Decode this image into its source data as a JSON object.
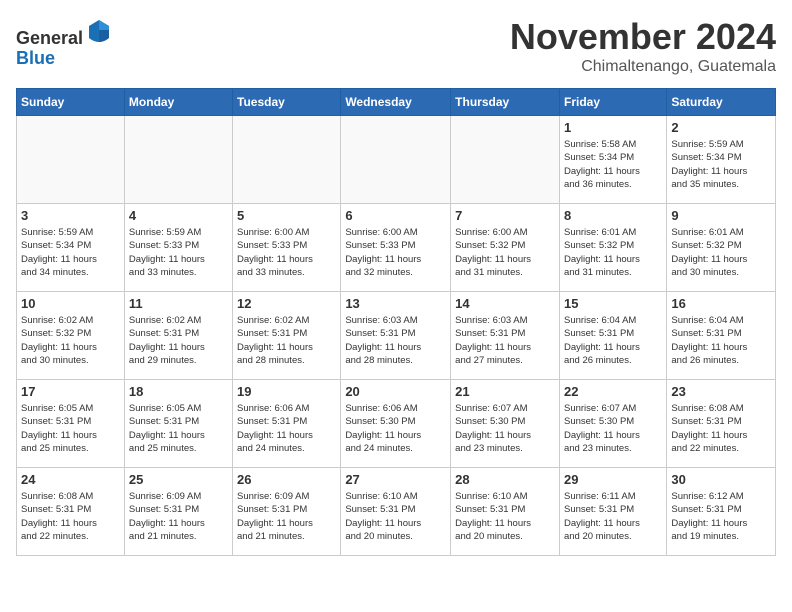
{
  "header": {
    "logo_general": "General",
    "logo_blue": "Blue",
    "month_title": "November 2024",
    "location": "Chimaltenango, Guatemala"
  },
  "weekdays": [
    "Sunday",
    "Monday",
    "Tuesday",
    "Wednesday",
    "Thursday",
    "Friday",
    "Saturday"
  ],
  "weeks": [
    [
      {
        "day": "",
        "info": ""
      },
      {
        "day": "",
        "info": ""
      },
      {
        "day": "",
        "info": ""
      },
      {
        "day": "",
        "info": ""
      },
      {
        "day": "",
        "info": ""
      },
      {
        "day": "1",
        "info": "Sunrise: 5:58 AM\nSunset: 5:34 PM\nDaylight: 11 hours\nand 36 minutes."
      },
      {
        "day": "2",
        "info": "Sunrise: 5:59 AM\nSunset: 5:34 PM\nDaylight: 11 hours\nand 35 minutes."
      }
    ],
    [
      {
        "day": "3",
        "info": "Sunrise: 5:59 AM\nSunset: 5:34 PM\nDaylight: 11 hours\nand 34 minutes."
      },
      {
        "day": "4",
        "info": "Sunrise: 5:59 AM\nSunset: 5:33 PM\nDaylight: 11 hours\nand 33 minutes."
      },
      {
        "day": "5",
        "info": "Sunrise: 6:00 AM\nSunset: 5:33 PM\nDaylight: 11 hours\nand 33 minutes."
      },
      {
        "day": "6",
        "info": "Sunrise: 6:00 AM\nSunset: 5:33 PM\nDaylight: 11 hours\nand 32 minutes."
      },
      {
        "day": "7",
        "info": "Sunrise: 6:00 AM\nSunset: 5:32 PM\nDaylight: 11 hours\nand 31 minutes."
      },
      {
        "day": "8",
        "info": "Sunrise: 6:01 AM\nSunset: 5:32 PM\nDaylight: 11 hours\nand 31 minutes."
      },
      {
        "day": "9",
        "info": "Sunrise: 6:01 AM\nSunset: 5:32 PM\nDaylight: 11 hours\nand 30 minutes."
      }
    ],
    [
      {
        "day": "10",
        "info": "Sunrise: 6:02 AM\nSunset: 5:32 PM\nDaylight: 11 hours\nand 30 minutes."
      },
      {
        "day": "11",
        "info": "Sunrise: 6:02 AM\nSunset: 5:31 PM\nDaylight: 11 hours\nand 29 minutes."
      },
      {
        "day": "12",
        "info": "Sunrise: 6:02 AM\nSunset: 5:31 PM\nDaylight: 11 hours\nand 28 minutes."
      },
      {
        "day": "13",
        "info": "Sunrise: 6:03 AM\nSunset: 5:31 PM\nDaylight: 11 hours\nand 28 minutes."
      },
      {
        "day": "14",
        "info": "Sunrise: 6:03 AM\nSunset: 5:31 PM\nDaylight: 11 hours\nand 27 minutes."
      },
      {
        "day": "15",
        "info": "Sunrise: 6:04 AM\nSunset: 5:31 PM\nDaylight: 11 hours\nand 26 minutes."
      },
      {
        "day": "16",
        "info": "Sunrise: 6:04 AM\nSunset: 5:31 PM\nDaylight: 11 hours\nand 26 minutes."
      }
    ],
    [
      {
        "day": "17",
        "info": "Sunrise: 6:05 AM\nSunset: 5:31 PM\nDaylight: 11 hours\nand 25 minutes."
      },
      {
        "day": "18",
        "info": "Sunrise: 6:05 AM\nSunset: 5:31 PM\nDaylight: 11 hours\nand 25 minutes."
      },
      {
        "day": "19",
        "info": "Sunrise: 6:06 AM\nSunset: 5:31 PM\nDaylight: 11 hours\nand 24 minutes."
      },
      {
        "day": "20",
        "info": "Sunrise: 6:06 AM\nSunset: 5:30 PM\nDaylight: 11 hours\nand 24 minutes."
      },
      {
        "day": "21",
        "info": "Sunrise: 6:07 AM\nSunset: 5:30 PM\nDaylight: 11 hours\nand 23 minutes."
      },
      {
        "day": "22",
        "info": "Sunrise: 6:07 AM\nSunset: 5:30 PM\nDaylight: 11 hours\nand 23 minutes."
      },
      {
        "day": "23",
        "info": "Sunrise: 6:08 AM\nSunset: 5:31 PM\nDaylight: 11 hours\nand 22 minutes."
      }
    ],
    [
      {
        "day": "24",
        "info": "Sunrise: 6:08 AM\nSunset: 5:31 PM\nDaylight: 11 hours\nand 22 minutes."
      },
      {
        "day": "25",
        "info": "Sunrise: 6:09 AM\nSunset: 5:31 PM\nDaylight: 11 hours\nand 21 minutes."
      },
      {
        "day": "26",
        "info": "Sunrise: 6:09 AM\nSunset: 5:31 PM\nDaylight: 11 hours\nand 21 minutes."
      },
      {
        "day": "27",
        "info": "Sunrise: 6:10 AM\nSunset: 5:31 PM\nDaylight: 11 hours\nand 20 minutes."
      },
      {
        "day": "28",
        "info": "Sunrise: 6:10 AM\nSunset: 5:31 PM\nDaylight: 11 hours\nand 20 minutes."
      },
      {
        "day": "29",
        "info": "Sunrise: 6:11 AM\nSunset: 5:31 PM\nDaylight: 11 hours\nand 20 minutes."
      },
      {
        "day": "30",
        "info": "Sunrise: 6:12 AM\nSunset: 5:31 PM\nDaylight: 11 hours\nand 19 minutes."
      }
    ]
  ]
}
